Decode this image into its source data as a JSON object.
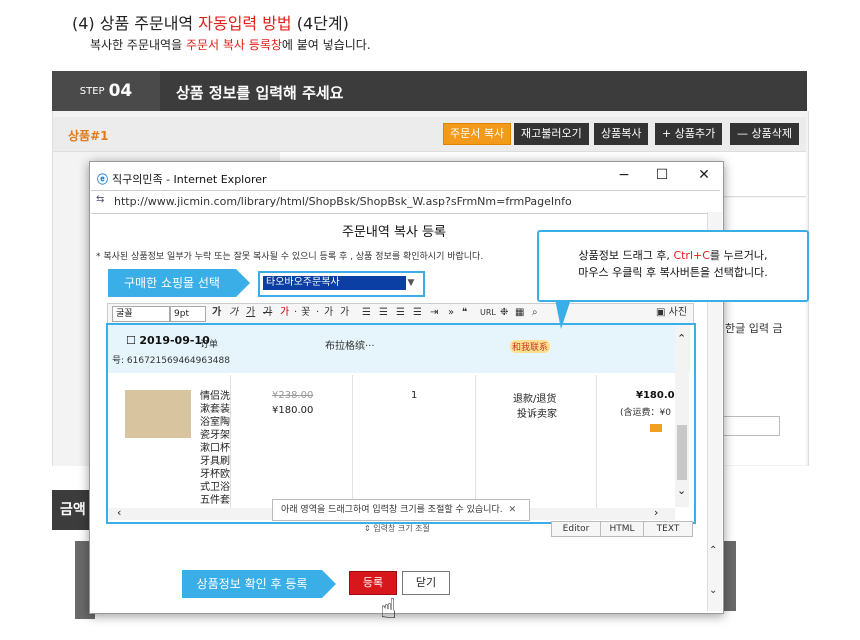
{
  "heading": {
    "prefix": "(4) 상품 주문내역 ",
    "highlight": "자동입력 방법",
    "suffix": " (4단계)"
  },
  "subheading": {
    "prefix": "복사한 주문내역을 ",
    "highlight": "주문서 복사 등록창",
    "suffix": "에 붙여 넣습니다."
  },
  "step": {
    "label": "STEP",
    "number": "04",
    "title": "상품 정보를 입력해 주세요"
  },
  "product_section": {
    "label": "상품#1",
    "buttons": {
      "order_copy": "주문서 복사",
      "reload_stock": "재고불러오기",
      "product_copy": "상품복사",
      "product_add": "+ 상품추가",
      "product_delete": "— 상품삭제"
    },
    "side_text": ", 한글 입력 금",
    "bottom_label": "금액"
  },
  "ie_window": {
    "title": "직구의민족 - Internet Explorer",
    "url": "http://www.jicmin.com/library/html/ShopBsk/ShopBsk_W.asp?sFrmNm=frmPageInfo",
    "controls": {
      "minimize": "−",
      "maximize": "☐",
      "close": "✕"
    }
  },
  "dialog": {
    "title": "주문내역 복사 등록",
    "notice": "* 복사된 상품정보 일부가 누락 또는 잘못 복사될 수 있으니 등록 후 , 상품 정보를 확인하시기 바랍니다.",
    "mall_callout": "구매한 쇼핑몰 선택",
    "mall_selected": "타오바오주문복사",
    "toolbar": {
      "font": "굴꼴",
      "size": "9pt",
      "items": [
        "가",
        "가",
        "가",
        "가",
        "가",
        "·",
        "꽃",
        "·",
        "가",
        "가"
      ],
      "extra": "사진"
    },
    "order": {
      "date": "2019-09-10",
      "keyword": "订单",
      "number_label": "号: ",
      "number": "616721569464963488",
      "shop": "布拉格缤···",
      "contact": "和我联系"
    },
    "item": {
      "name": "情侣洗漱套装浴室陶瓷牙架漱口杯牙具刷牙杯欧式卫浴五件套",
      "price_old": "¥238.00",
      "price_new": "¥180.00",
      "qty": "1",
      "status1": "退款/退货",
      "status2": "投诉卖家",
      "total": "¥180.0",
      "total_sub": "(含运费：¥0"
    },
    "drag_tip": "아래 영역을 드래그하여 입력창 크기를 조절할 수 있습니다.",
    "resize_label": "⇕ 입력창 크기 조절",
    "modes": {
      "editor": "Editor",
      "html": "HTML",
      "text": "TEXT"
    },
    "callout_line1_prefix": "상품정보 드래그 후, ",
    "callout_line1_highlight": "Ctrl+C",
    "callout_line1_suffix": "를 누르거나,",
    "callout_line2": "마우스 우클릭 후 복사버튼을 선택합니다.",
    "register_callout": "상품정보 확인 후 등록",
    "register_button": "등록",
    "close_button": "닫기"
  },
  "colors": {
    "accent_blue": "#3aaee6",
    "highlight_red": "#e0201a",
    "step_bar": "#3c3c3c",
    "copy_button": "#f49a1a",
    "register_button": "#d8171c"
  }
}
